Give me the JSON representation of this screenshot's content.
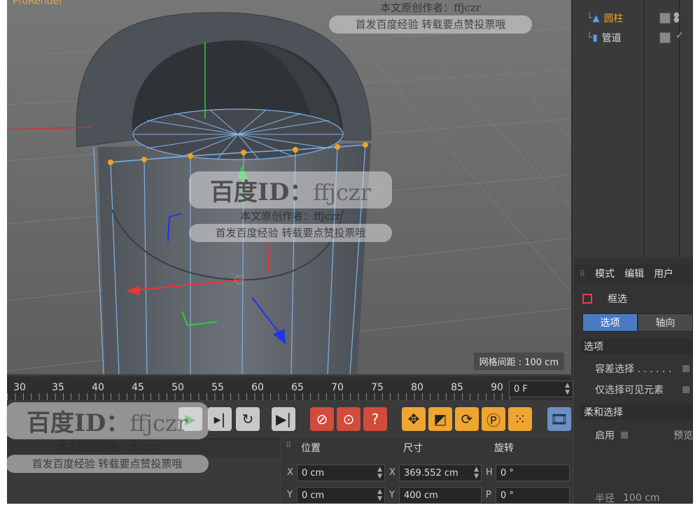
{
  "viewport": {
    "title": "ProRender",
    "grid_spacing": "网格间距 : 100 cm"
  },
  "objects": [
    {
      "label": "圆柱",
      "icon": "cylinder-icon",
      "highlighted": true
    },
    {
      "label": "管道",
      "icon": "tube-icon",
      "highlighted": false
    }
  ],
  "attributes": {
    "menu": [
      "模式",
      "编辑",
      "用户"
    ],
    "tool_label": "框选",
    "tabs": [
      "选项",
      "轴向"
    ],
    "section_options": "选项",
    "tolerance_label": "容差选择 . . . . . .",
    "visible_only_label": "仅选择可见元素",
    "section_soft": "柔和选择",
    "enable_label": "启用",
    "preview_label": "预览",
    "radius_label": "半径",
    "radius_value": "100 cm"
  },
  "timeline": {
    "ticks": [
      "30",
      "35",
      "40",
      "45",
      "50",
      "55",
      "60",
      "65",
      "70",
      "75",
      "80",
      "85",
      "90"
    ],
    "current_frame": "0 F"
  },
  "coordinates": {
    "headers": {
      "position": "位置",
      "size": "尺寸",
      "rotation": "旋转"
    },
    "rows": [
      {
        "pos_axis": "X",
        "pos": "0 cm",
        "size_axis": "X",
        "size": "369.552 cm",
        "rot_axis": "H",
        "rot": "0 °"
      },
      {
        "pos_axis": "Y",
        "pos": "0 cm",
        "size_axis": "Y",
        "size": "400 cm",
        "rot_axis": "P",
        "rot": "0 °"
      }
    ]
  },
  "watermarks": [
    {
      "title": "百度ID：",
      "id": "ffjczr",
      "line1": "本文原创作者：ffjczr",
      "line2": "首发百度经验  转载要点赞投票哦"
    }
  ],
  "colors": {
    "accent_orange": "#f0a530",
    "active_blue": "#4a7bc2",
    "record_red": "#d24b3b"
  }
}
